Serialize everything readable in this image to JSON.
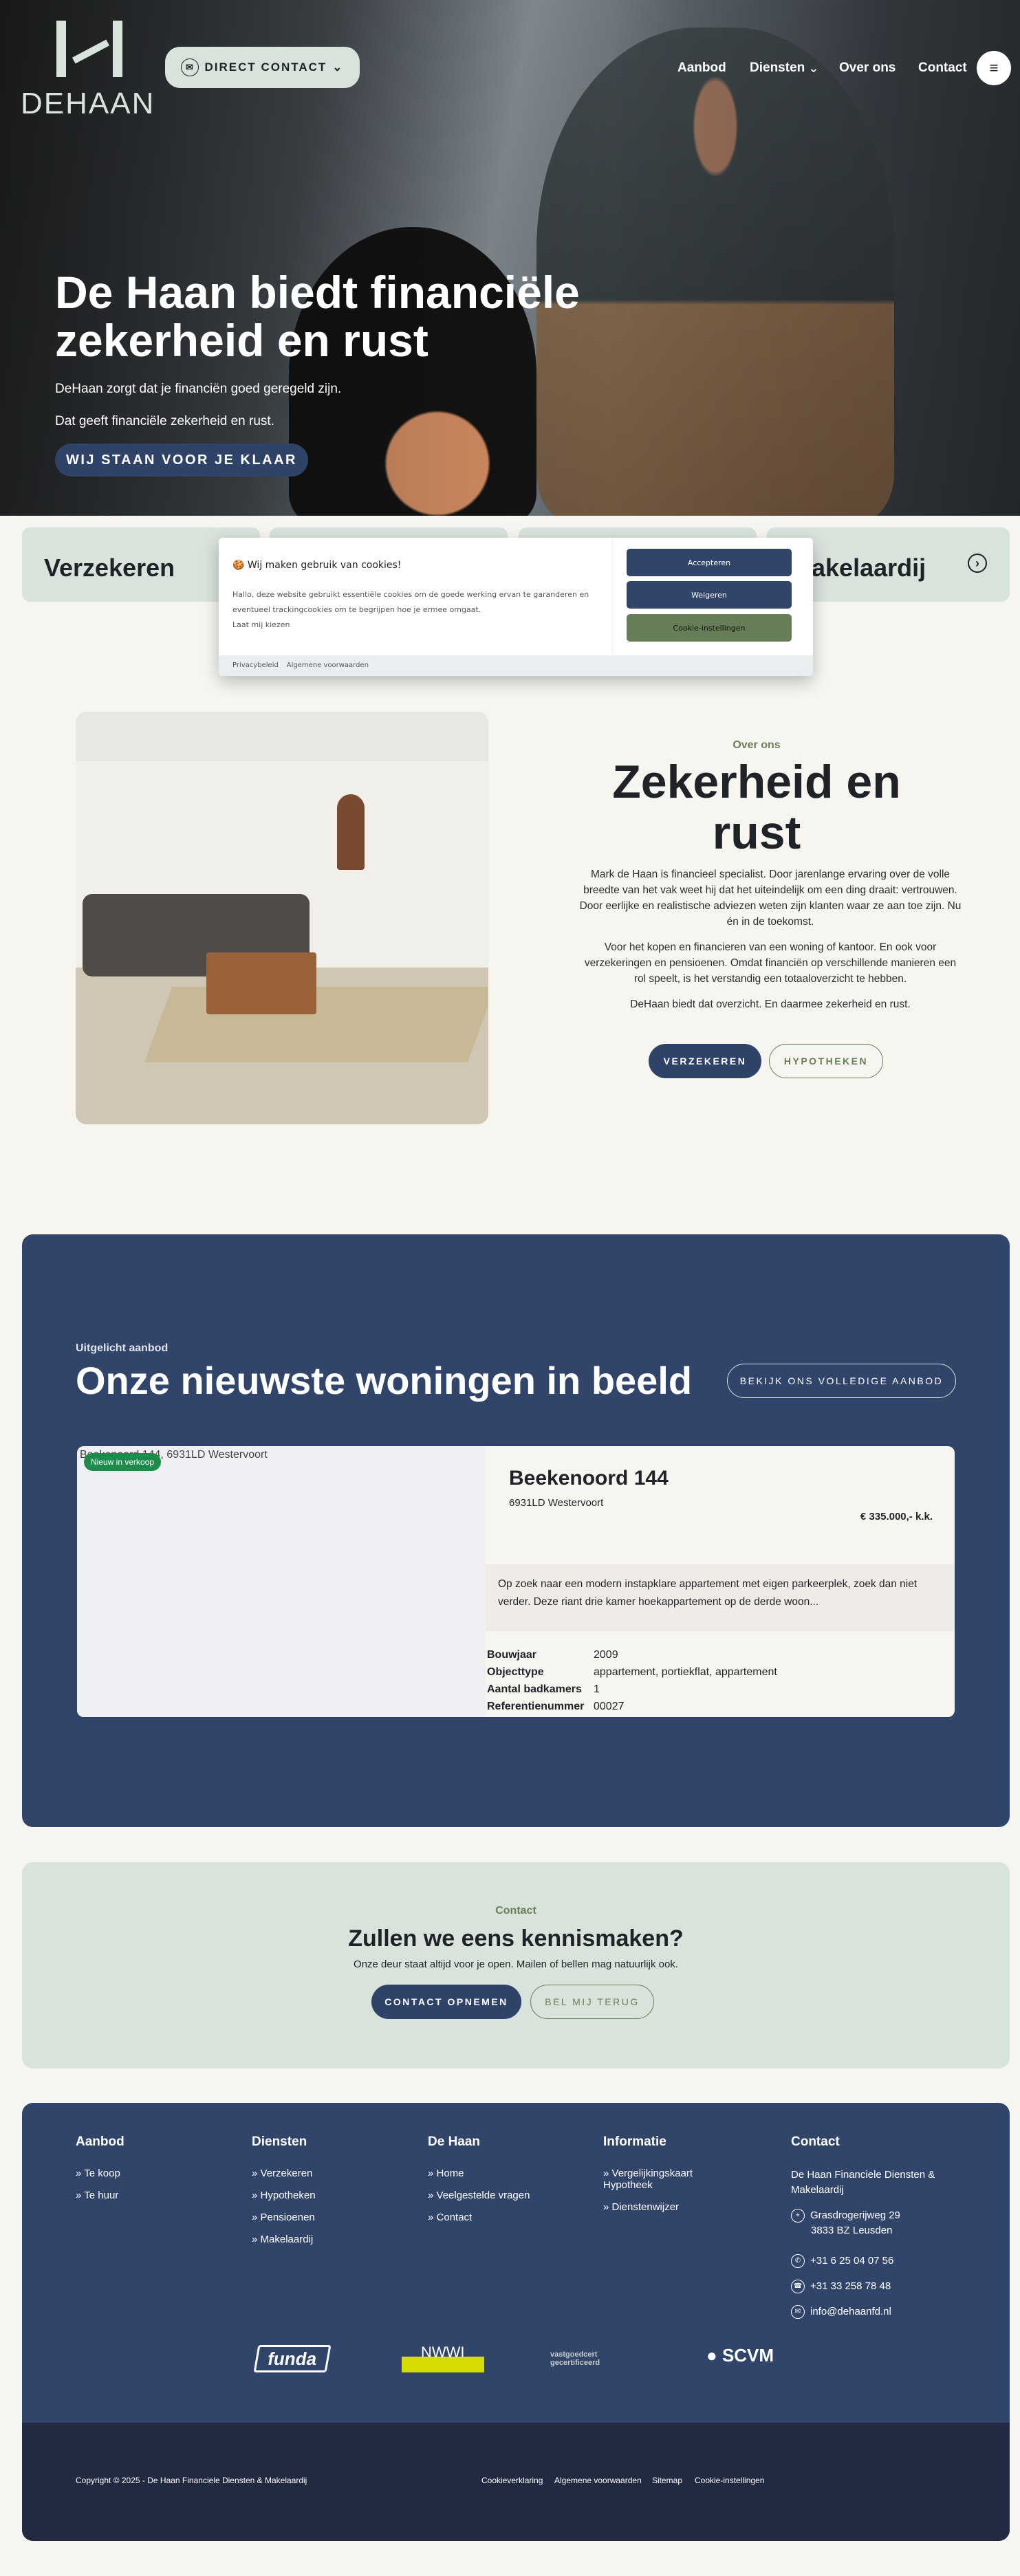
{
  "colors": {
    "navy": "#2f4368",
    "sage": "#d8e3dc",
    "green": "#6a7f58",
    "cream": "#f7f5f0",
    "footer_dark": "#222a42"
  },
  "header": {
    "logo_text": "DEHAAN",
    "direct_contact": "DIRECT CONTACT",
    "direct_contact_icon": "mail-icon",
    "nav": [
      "Aanbod",
      "Diensten",
      "Over ons",
      "Contact"
    ],
    "menu_icon": "hamburger-icon"
  },
  "hero": {
    "title": "De Haan biedt financiële zekerheid en rust",
    "line1": "DeHaan zorgt dat je financiën goed geregeld zijn.",
    "line2": "Dat geeft financiële zekerheid en rust.",
    "cta": "WIJ STAAN VOOR JE KLAAR"
  },
  "services": {
    "first": "Verzekeren",
    "last": "akelaardij",
    "arrow_icon": "chevron-right-circle-icon"
  },
  "cookie": {
    "title": "Wij maken gebruik van cookies!",
    "text": "Hallo, deze website gebruikt essentiële cookies om de goede werking ervan te garanderen en eventueel trackingcookies om te begrijpen hoe je ermee omgaat.",
    "choose": "Laat mij kiezen",
    "accept": "Accepteren",
    "reject": "Weigeren",
    "settings": "Cookie-instellingen",
    "privacy": "Privacybeleid",
    "terms": "Algemene voorwaarden"
  },
  "about": {
    "eyebrow": "Over ons",
    "title": "Zekerheid en rust",
    "p1": "Mark de Haan is financieel specialist. Door jarenlange ervaring over de volle breedte van het vak weet hij dat het uiteindelijk om een ding draait: vertrouwen. Door eerlijke en realistische adviezen weten zijn klanten waar ze aan toe zijn. Nu én in de toekomst.",
    "p2": "Voor het kopen en financieren van een woning of kantoor. En ook voor verzekeringen en pensioenen. Omdat financiën op verschillende manieren een rol speelt, is het verstandig een totaaloverzicht te hebben.",
    "p3": "DeHaan biedt dat overzicht. En daarmee zekerheid en rust.",
    "btn1": "VERZEKEREN",
    "btn2": "HYPOTHEKEN"
  },
  "listings": {
    "eyebrow": "Uitgelicht aanbod",
    "title": "Onze nieuwste woningen in beeld",
    "all": "BEKIJK ONS VOLLEDIGE AANBOD",
    "item": {
      "img_alt": "Beekenoord 144, 6931LD Westervoort",
      "badge": "Nieuw in verkoop",
      "title": "Beekenoord 144",
      "city": "6931LD Westervoort",
      "price": "€ 335.000,- k.k.",
      "desc": "Op zoek naar een modern instapklare appartement met eigen parkeerplek, zoek dan niet verder. Deze riant drie kamer hoekappartement op de derde woon...",
      "specs": [
        {
          "k": "Bouwjaar",
          "v": "2009"
        },
        {
          "k": "Objecttype",
          "v": "appartement, portiekflat, appartement"
        },
        {
          "k": "Aantal badkamers",
          "v": "1"
        },
        {
          "k": "Referentienummer",
          "v": "00027"
        }
      ]
    }
  },
  "contact": {
    "eyebrow": "Contact",
    "title": "Zullen we eens kennismaken?",
    "text": "Onze deur staat altijd voor je open. Mailen of bellen mag natuurlijk ook.",
    "btn1": "CONTACT OPNEMEN",
    "btn2": "BEL MIJ TERUG"
  },
  "footer": {
    "cols": [
      {
        "title": "Aanbod",
        "items": [
          "Te koop",
          "Te huur"
        ]
      },
      {
        "title": "Diensten",
        "items": [
          "Verzekeren",
          "Hypotheken",
          "Pensioenen",
          "Makelaardij"
        ]
      },
      {
        "title": "De Haan",
        "items": [
          "Home",
          "Veelgestelde vragen",
          "Contact"
        ]
      },
      {
        "title": "Informatie",
        "items": [
          "Vergelijkingskaart Hypotheek",
          "Dienstenwijzer"
        ]
      }
    ],
    "contact_title": "Contact",
    "company": "De Haan Financiele Diensten & Makelaardij",
    "street": "Grasdrogerijweg 29",
    "city": "3833 BZ Leusden",
    "mobile": "+31 6 25 04 07 56",
    "phone": "+31 33 258 78 48",
    "email": "info@dehaanfd.nl",
    "logos": [
      "funda",
      "NWWI",
      "vastgoedcert gecertificeerd",
      "SCVM"
    ],
    "copyright": "Copyright © 2025 - De Haan Financiele Diensten & Makelaardij",
    "links": [
      "Cookieverklaring",
      "Algemene voorwaarden",
      "Sitemap",
      "Cookie-instellingen"
    ]
  }
}
